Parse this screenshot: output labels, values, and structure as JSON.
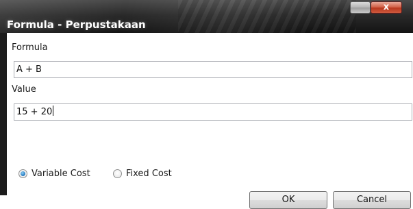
{
  "window": {
    "title": "Formula - Perpustakaan",
    "close_glyph": "x",
    "icons": [
      "minimize-icon",
      "close-icon"
    ]
  },
  "form": {
    "formula_label": "Formula",
    "formula_value": "A + B",
    "value_label": "Value",
    "value_value": "15 + 20"
  },
  "cost_type": {
    "options": [
      {
        "label": "Variable Cost",
        "checked": true
      },
      {
        "label": "Fixed Cost",
        "checked": false
      }
    ]
  },
  "buttons": {
    "ok_label": "OK",
    "cancel_label": "Cancel"
  },
  "colors": {
    "titlebar": "#2a2a2a",
    "close_button": "#c84b30",
    "radio_selected": "#2a7fc4"
  }
}
